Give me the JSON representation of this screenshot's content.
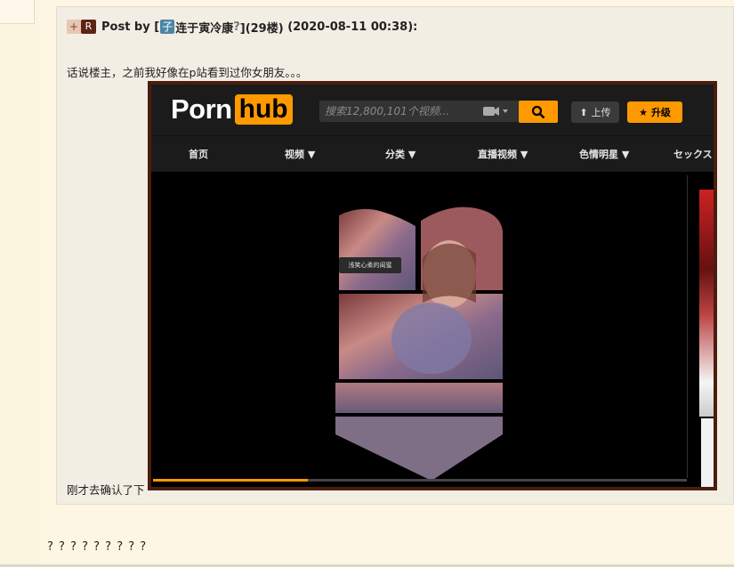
{
  "post": {
    "plus": "+",
    "r_badge": "R",
    "post_by": "Post by [",
    "user_badge": "子",
    "username": "连于寅冷康",
    "question_mark": "?",
    "floor": "](29楼)",
    "datetime": " (2020-08-11 00:38):",
    "body_line1": "话说楼主，之前我好像在p站看到过你女朋友。。。",
    "body_line2": "刚才去确认了下"
  },
  "reply_text": "? ? ? ? ? ? ? ? ?",
  "screenshot": {
    "logo_left": "Porn",
    "logo_right": "hub",
    "search_placeholder": "搜索12,800,101个视频...",
    "upload_label": "上传",
    "upgrade_label": "升级",
    "nav": [
      "首页",
      "视频 ▼",
      "分类 ▼",
      "直播视频 ▼",
      "色情明星 ▼",
      "セックスし"
    ],
    "photo_tag": "浅笑心柔的闺蜜",
    "progress_fraction": 0.29
  },
  "colors": {
    "page_bg": "#fdf6e3",
    "post_bg": "#f3eee3",
    "brand_orange": "#ff9900",
    "frame_border": "#4b1d0e"
  }
}
